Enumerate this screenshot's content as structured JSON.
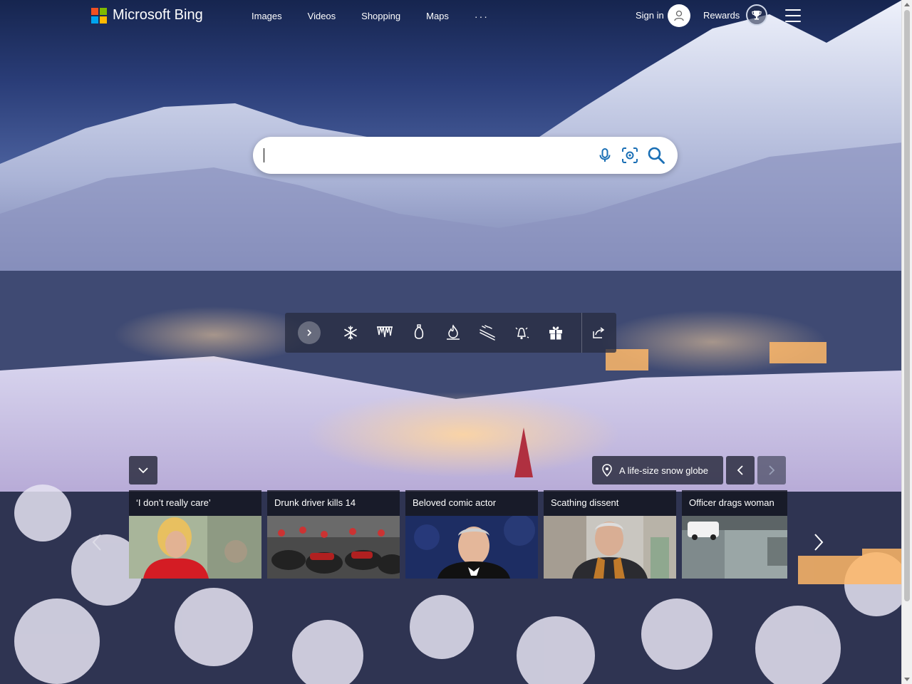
{
  "brand": {
    "name": "Microsoft Bing",
    "logo_colors": [
      "#f25022",
      "#7fba00",
      "#00a4ef",
      "#ffb900"
    ]
  },
  "nav": {
    "items": [
      "Images",
      "Videos",
      "Shopping",
      "Maps"
    ],
    "more": "···"
  },
  "account": {
    "signin": "Sign in",
    "rewards": "Rewards"
  },
  "search": {
    "value": "",
    "placeholder": "",
    "accent": "#1a6fb5"
  },
  "toolbar": {
    "icons": [
      "snowflake-icon",
      "icicles-icon",
      "ornament-icon",
      "fire-icon",
      "ski-icon",
      "bell-icon",
      "gift-icon"
    ]
  },
  "hero": {
    "caption": "A life-size snow globe"
  },
  "news": [
    {
      "title": "‘I don’t really care’"
    },
    {
      "title": "Drunk driver kills 14"
    },
    {
      "title": "Beloved comic actor"
    },
    {
      "title": "Scathing dissent"
    },
    {
      "title": "Officer drags woman"
    }
  ]
}
